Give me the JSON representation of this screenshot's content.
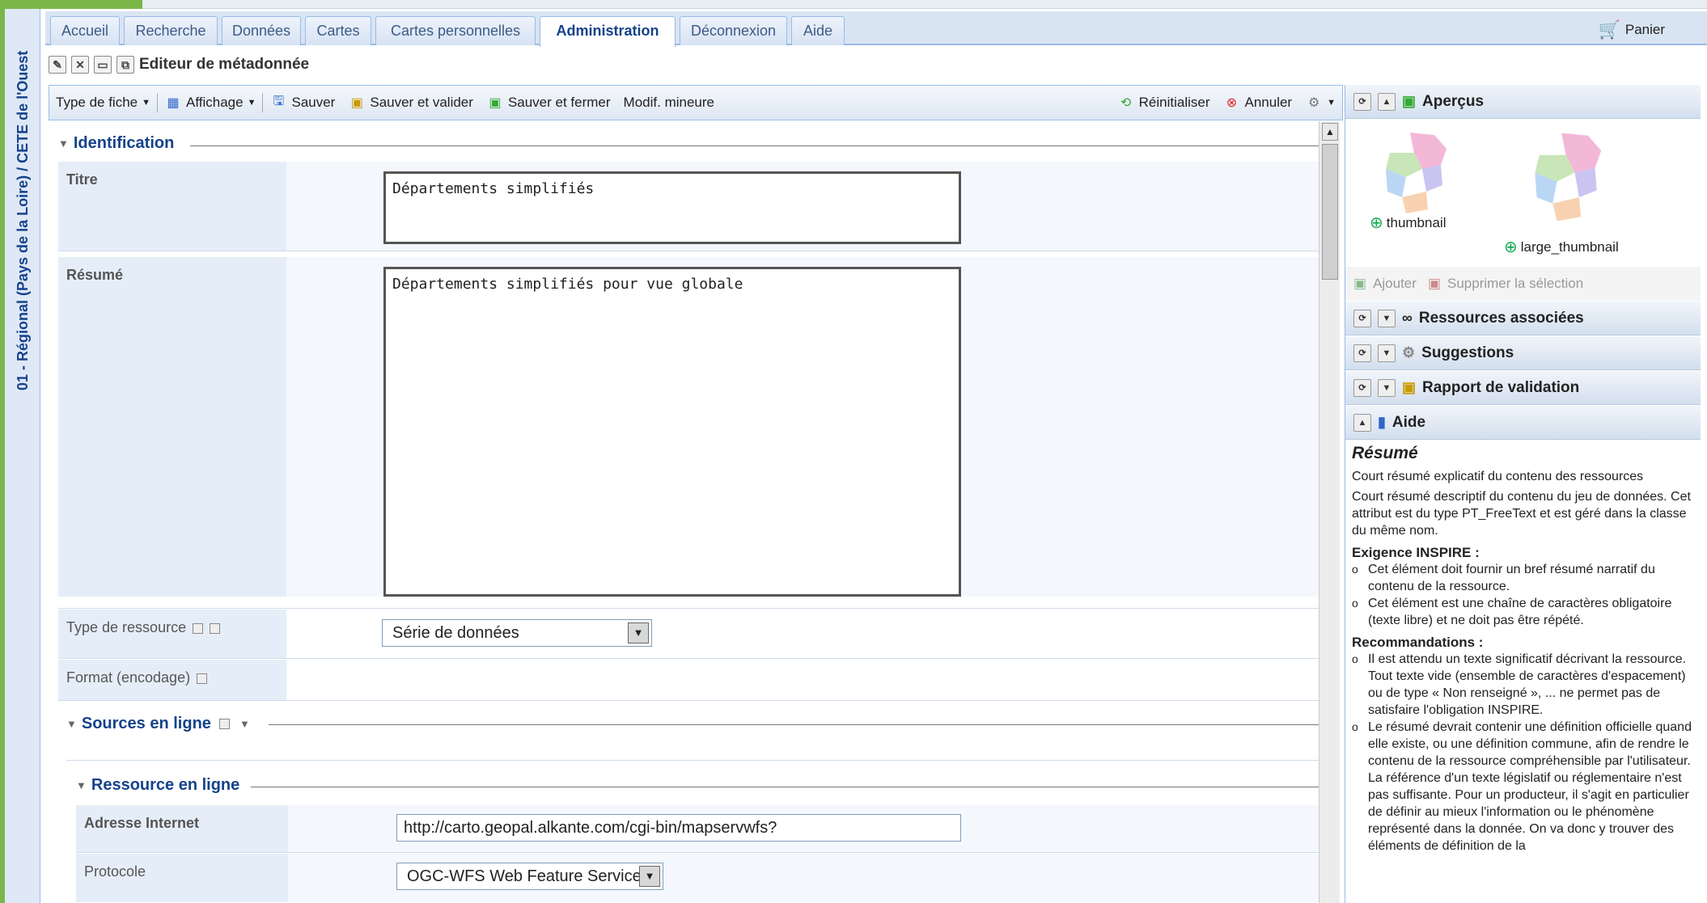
{
  "sidebar_title": "01 - Régional (Pays de la Loire) / CETE de l'Ouest",
  "tabs": [
    "Accueil",
    "Recherche",
    "Données",
    "Cartes",
    "Cartes personnelles",
    "Administration",
    "Déconnexion",
    "Aide"
  ],
  "active_tab": "Administration",
  "cart_label": "Panier",
  "editor_title": "Editeur de métadonnée",
  "toolbar": {
    "type_fiche": "Type de fiche",
    "affichage": "Affichage",
    "sauver": "Sauver",
    "sauver_valider": "Sauver et valider",
    "sauver_fermer": "Sauver et fermer",
    "modif_mineure": "Modif. mineure",
    "reinitialiser": "Réinitialiser",
    "annuler": "Annuler"
  },
  "form": {
    "identification": "Identification",
    "titre_label": "Titre",
    "titre_value": "Départements simplifiés",
    "resume_label": "Résumé",
    "resume_value": "Départements simplifiés pour vue globale",
    "type_ressource_label": "Type de ressource",
    "type_ressource_value": "Série de données",
    "format_label": "Format (encodage)",
    "sources_en_ligne": "Sources en ligne",
    "ressource_en_ligne": "Ressource en ligne",
    "adresse_label": "Adresse Internet",
    "adresse_value": "http://carto.geopal.alkante.com/cgi-bin/mapservwfs?",
    "protocole_label": "Protocole",
    "protocole_value": "OGC-WFS Web Feature Service"
  },
  "right_panel": {
    "apercus": "Aperçus",
    "thumb1": "thumbnail",
    "thumb2": "large_thumbnail",
    "ajouter": "Ajouter",
    "supprimer": "Supprimer la sélection",
    "ressources": "Ressources associées",
    "suggestions": "Suggestions",
    "rapport": "Rapport de validation",
    "aide": "Aide"
  },
  "help": {
    "title": "Résumé",
    "p1": "Court résumé explicatif du contenu des ressources",
    "p2": "Court résumé descriptif du contenu du jeu de données. Cet attribut est du type PT_FreeText et est géré dans la classe du même nom.",
    "h_inspire": "Exigence INSPIRE :",
    "inspire": [
      "Cet élément doit fournir un bref résumé narratif du contenu de la ressource.",
      "Cet élément est une chaîne de caractères obligatoire (texte libre) et ne doit pas être répété."
    ],
    "h_reco": "Recommandations :",
    "reco": [
      "Il est attendu un texte significatif décrivant la ressource. Tout texte vide (ensemble de caractères d'espacement) ou de type « Non renseigné », ... ne permet pas de satisfaire l'obligation INSPIRE.",
      "Le résumé devrait contenir une définition officielle quand elle existe, ou une définition commune, afin de rendre le contenu de la ressource compréhensible par l'utilisateur. La référence d'un texte législatif ou réglementaire n'est pas suffisante. Pour un producteur, il s'agit en particulier de définir au mieux l'information ou le phénomène représenté dans la donnée. On va donc y trouver des éléments de définition de la"
    ]
  }
}
